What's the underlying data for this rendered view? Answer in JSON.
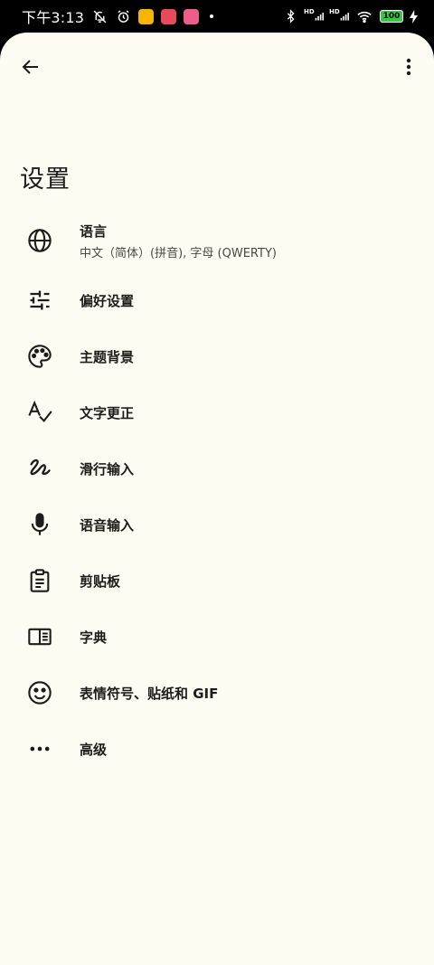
{
  "status_bar": {
    "time": "下午3:13",
    "battery": "100",
    "signal_label_1": "HD",
    "signal_label_2": "HD"
  },
  "header": {
    "title": "设置"
  },
  "menu": {
    "items": [
      {
        "id": "language",
        "label": "语言",
        "sub": "中文（简体）(拼音), 字母 (QWERTY)",
        "icon": "globe-icon"
      },
      {
        "id": "preferences",
        "label": "偏好设置",
        "icon": "sliders-icon"
      },
      {
        "id": "theme",
        "label": "主题背景",
        "icon": "palette-icon"
      },
      {
        "id": "text-correction",
        "label": "文字更正",
        "icon": "spellcheck-icon"
      },
      {
        "id": "glide-typing",
        "label": "滑行输入",
        "icon": "gesture-icon"
      },
      {
        "id": "voice-typing",
        "label": "语音输入",
        "icon": "microphone-icon"
      },
      {
        "id": "clipboard",
        "label": "剪贴板",
        "icon": "clipboard-icon"
      },
      {
        "id": "dictionary",
        "label": "字典",
        "icon": "book-icon"
      },
      {
        "id": "emoji",
        "label": "表情符号、贴纸和 GIF",
        "icon": "smiley-icon"
      },
      {
        "id": "advanced",
        "label": "高级",
        "icon": "more-horizontal-icon"
      }
    ]
  },
  "colors": {
    "background": "#fdfbf2",
    "text": "#1d1c1a",
    "battery": "#37c84a"
  }
}
